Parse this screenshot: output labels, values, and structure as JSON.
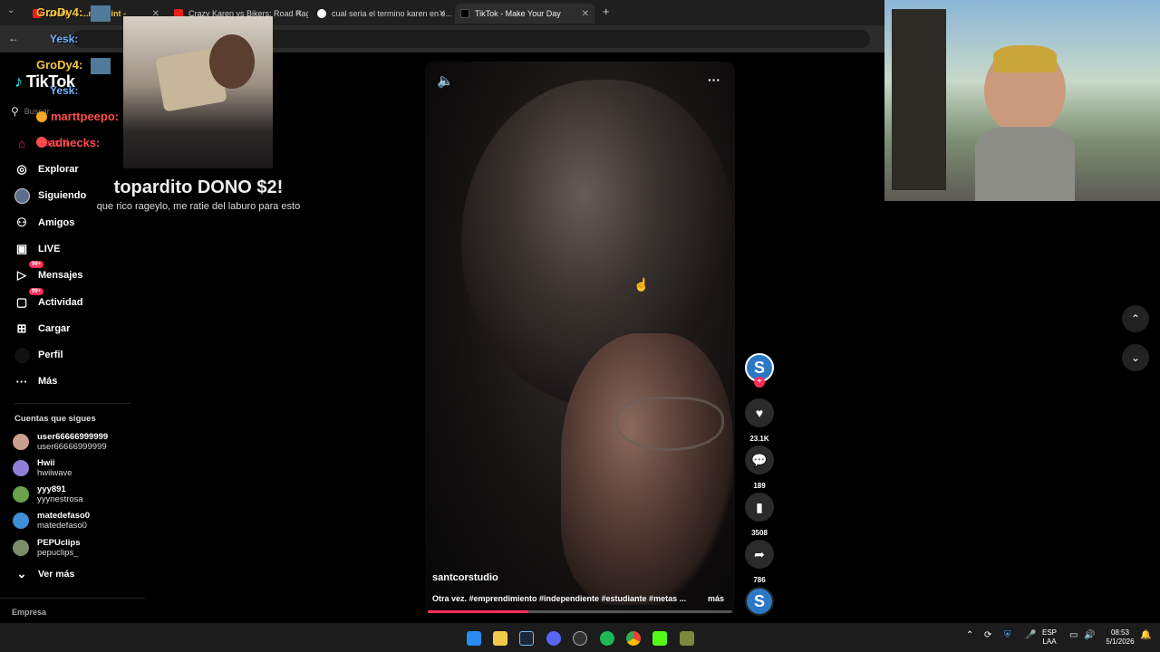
{
  "browser": {
    "tabs": [
      {
        "title": "GroDy4: ...ng Point -",
        "favicon_color": "#e62117"
      },
      {
        "title": "Crazy Karen vs Bikers: Road Rag...",
        "favicon_color": "#e62117"
      },
      {
        "title": "cual seria el termino karen en e...",
        "favicon_color": "#4285f4"
      },
      {
        "title": "TikTok - Make Your Day",
        "favicon_color": "#000000"
      }
    ],
    "new_tab": "+"
  },
  "tiktok": {
    "logo": "TikTok",
    "search_placeholder": "Buscar",
    "nav": [
      {
        "label": "Para ti",
        "icon": "home-icon"
      },
      {
        "label": "Explorar",
        "icon": "compass-icon"
      },
      {
        "label": "Siguiendo",
        "icon": "following-icon"
      },
      {
        "label": "Amigos",
        "icon": "friends-icon"
      },
      {
        "label": "LIVE",
        "icon": "live-icon"
      },
      {
        "label": "Mensajes",
        "icon": "message-icon",
        "badge": "99+"
      },
      {
        "label": "Actividad",
        "icon": "activity-icon",
        "badge": "99+"
      },
      {
        "label": "Cargar",
        "icon": "upload-icon"
      },
      {
        "label": "Perfil",
        "icon": "profile-icon"
      },
      {
        "label": "Más",
        "icon": "more-icon"
      }
    ],
    "following_title": "Cuentas que sigues",
    "following": [
      {
        "name": "user66666999999",
        "username": "user66666999999",
        "avatar_color": "#c9a08e"
      },
      {
        "name": "Hwii",
        "username": "hwiiwave",
        "avatar_color": "#8f7fd8"
      },
      {
        "name": "yyy891",
        "username": "yyynestrosa",
        "avatar_color": "#6aa24a"
      },
      {
        "name": "matedefaso0",
        "username": "matedefaso0",
        "avatar_color": "#3d8fd8"
      },
      {
        "name": "PEPUclips",
        "username": "pepuclips_",
        "avatar_color": "#7b8c6a"
      }
    ],
    "see_more": "Ver más",
    "footer": "Empresa"
  },
  "video": {
    "author": "santcorstudio",
    "caption": "Otra vez. #emprendimiento #independiente #estudiante #metas ...",
    "more": "más",
    "progress": 0.33,
    "likes": "23.1K",
    "comments": "189",
    "saves": "3508",
    "shares": "786"
  },
  "stream_overlay": {
    "chat": [
      {
        "user": "GroDy4:",
        "color": "#f5c542"
      },
      {
        "user": "Yesk:",
        "color": "#6fb3ff"
      },
      {
        "user": "marttpeepo:",
        "color": "#ff4d4d"
      },
      {
        "user": "adnecks:",
        "color": "#ff4d4d"
      }
    ],
    "donation_title": "topardito DONO $2!",
    "donation_message": "que rico rageylo, me ratie del laburo para esto"
  },
  "taskbar": {
    "lang": "ESP",
    "lang_sub": "LAA",
    "time": "08:53",
    "date": "5/1/2026"
  }
}
